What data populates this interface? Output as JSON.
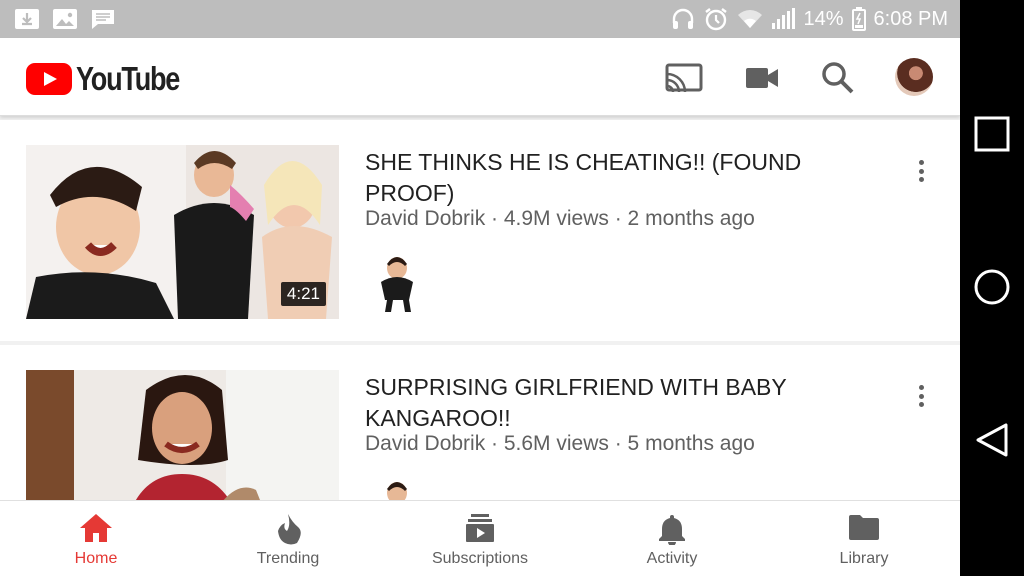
{
  "status_bar": {
    "battery": "14%",
    "time": "6:08 PM",
    "left_icons": [
      "download-icon",
      "image-icon",
      "message-icon"
    ],
    "right_icons": [
      "headphones-icon",
      "alarm-icon",
      "wifi-icon",
      "signal-icon",
      "battery-icon"
    ]
  },
  "app_bar": {
    "logo_text": "YouTube",
    "icons": [
      "cast-icon",
      "video-camera-icon",
      "search-icon",
      "account-avatar"
    ]
  },
  "videos": [
    {
      "title": "SHE THINKS HE IS CHEATING!! (FOUND PROOF)",
      "meta": "David Dobrik · 4.9M views · 2 months ago",
      "duration": "4:21"
    },
    {
      "title": "SURPRISING GIRLFRIEND WITH BABY KANGAROO!!",
      "meta": "David Dobrik · 5.6M views · 5 months ago",
      "duration": ""
    }
  ],
  "bottom_nav": [
    {
      "label": "Home",
      "icon": "home-icon",
      "active": true
    },
    {
      "label": "Trending",
      "icon": "flame-icon",
      "active": false
    },
    {
      "label": "Subscriptions",
      "icon": "subscriptions-icon",
      "active": false
    },
    {
      "label": "Activity",
      "icon": "bell-icon",
      "active": false
    },
    {
      "label": "Library",
      "icon": "folder-icon",
      "active": false
    }
  ],
  "android_nav": [
    "recents-icon",
    "home-circle-icon",
    "back-icon"
  ],
  "colors": {
    "brand_red": "#ff0000",
    "active_nav": "#e53935",
    "status_bar": "#bdbdbd",
    "text_primary": "#212121",
    "text_secondary": "#606060"
  }
}
